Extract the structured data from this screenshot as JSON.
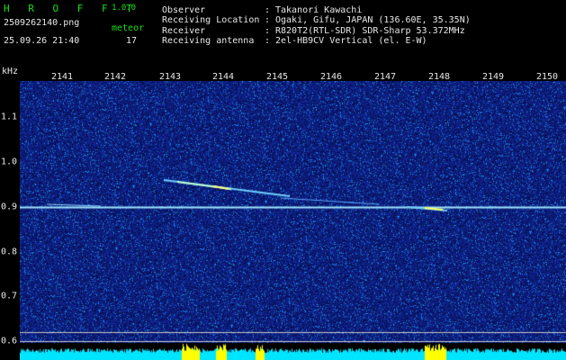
{
  "header": {
    "app_title": "H R O F F T",
    "version": "1.0.0",
    "filename": "2509262140.png",
    "datetime": "25.09.26 21:40",
    "meteor_label": "meteor",
    "meteor_count": "17"
  },
  "info": [
    {
      "label": "Observer",
      "sep": ":",
      "value": "Takanori Kawachi"
    },
    {
      "label": "Receiving Location",
      "sep": ":",
      "value": "Ogaki, Gifu, JAPAN (136.60E, 35.35N)"
    },
    {
      "label": "Receiver",
      "sep": ":",
      "value": "R820T2(RTL-SDR) SDR-Sharp 53.372MHz"
    },
    {
      "label": "Receiving antenna",
      "sep": ":",
      "value": "2el-HB9CV Vertical (el. E-W)"
    }
  ],
  "spectrogram": {
    "unit": "kHz",
    "time_ticks": [
      "2141",
      "2142",
      "2143",
      "2144",
      "2145",
      "2146",
      "2147",
      "2148",
      "2149",
      "2150"
    ],
    "freq_ticks": [
      "1.1",
      "1.0",
      "0.9",
      "0.8",
      "0.7",
      "0.6"
    ],
    "colors": {
      "background": "#0a0a5a",
      "noise": "#1e2fd0",
      "trace": "#9fe8ff",
      "hot": "#ffff40",
      "baseline": "#00e5ff",
      "marker": "#ffff00",
      "gridline": "#c8c8c8"
    }
  }
}
